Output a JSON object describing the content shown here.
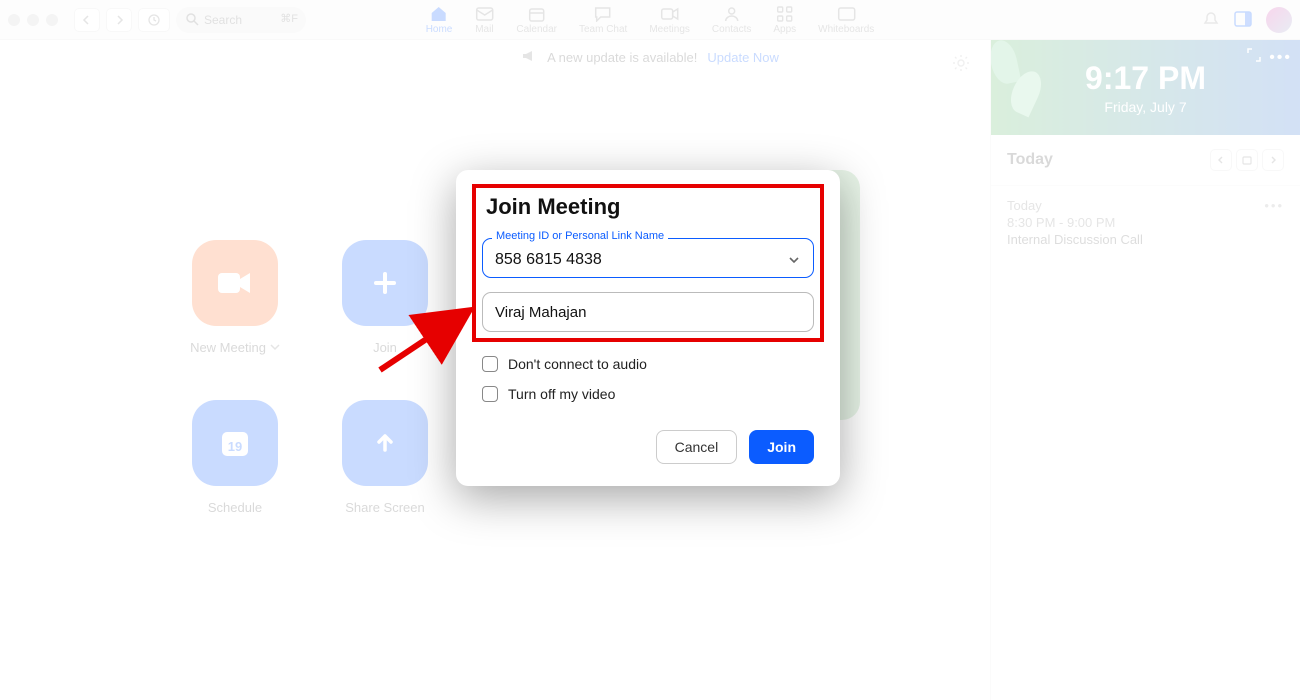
{
  "toolbar": {
    "search_placeholder": "Search",
    "search_hint": "⌘F"
  },
  "nav": {
    "home": "Home",
    "mail": "Mail",
    "calendar": "Calendar",
    "team_chat": "Team Chat",
    "meetings": "Meetings",
    "contacts": "Contacts",
    "apps": "Apps",
    "whiteboards": "Whiteboards"
  },
  "banner": {
    "text": "A new update is available!",
    "link": "Update Now"
  },
  "tiles": {
    "new_meeting": "New Meeting",
    "join": "Join",
    "schedule": "Schedule",
    "share_screen": "Share Screen",
    "date_num": "19"
  },
  "right_panel": {
    "time": "9:17 PM",
    "date": "Friday, July 7",
    "today_label": "Today",
    "event": {
      "day": "Today",
      "time": "8:30 PM - 9:00 PM",
      "name": "Internal Discussion Call"
    }
  },
  "modal": {
    "title": "Join Meeting",
    "id_label": "Meeting ID or Personal Link Name",
    "id_value": "858 6815 4838",
    "name_value": "Viraj Mahajan",
    "opt_audio": "Don't connect to audio",
    "opt_video": "Turn off my video",
    "cancel": "Cancel",
    "join": "Join"
  },
  "colors": {
    "primary": "#0b5cff",
    "orange": "#ff742e",
    "highlight": "#e60000"
  }
}
